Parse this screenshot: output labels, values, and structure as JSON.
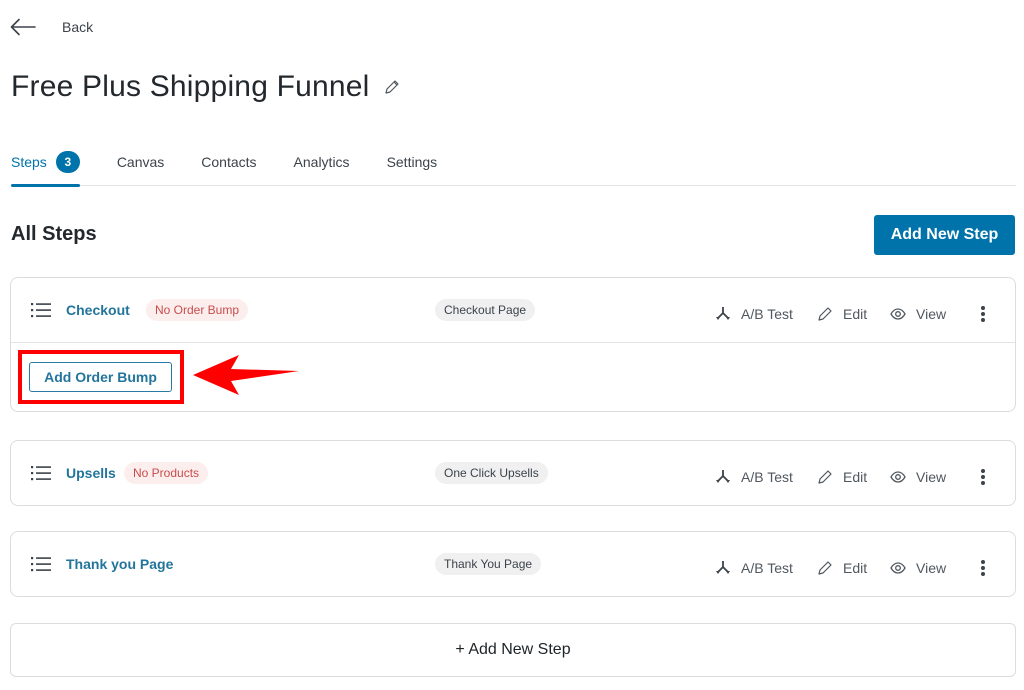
{
  "header": {
    "back_label": "Back",
    "title": "Free Plus Shipping Funnel"
  },
  "tabs": [
    {
      "label": "Steps",
      "count": "3",
      "active": true
    },
    {
      "label": "Canvas"
    },
    {
      "label": "Contacts"
    },
    {
      "label": "Analytics"
    },
    {
      "label": "Settings"
    }
  ],
  "main": {
    "section_title": "All Steps",
    "add_new_step_label": "Add New Step",
    "add_new_step_bottom_label": "+ Add New Step"
  },
  "actions": {
    "ab_test": "A/B Test",
    "edit": "Edit",
    "view": "View"
  },
  "steps": [
    {
      "name": "Checkout",
      "status_badge": "No Order Bump",
      "type": "Checkout Page",
      "sub_action": "Add Order Bump"
    },
    {
      "name": "Upsells",
      "status_badge": "No Products",
      "type": "One Click Upsells"
    },
    {
      "name": "Thank you Page",
      "type": "Thank You Page"
    }
  ],
  "annotation": {
    "color": "#ff0000",
    "target": "Add Order Bump"
  },
  "colors": {
    "accent": "#0073aa",
    "link": "#23759c",
    "danger_text": "#c94b4b",
    "danger_bg": "#fdeeee",
    "chip_bg": "#f0f0f1"
  }
}
